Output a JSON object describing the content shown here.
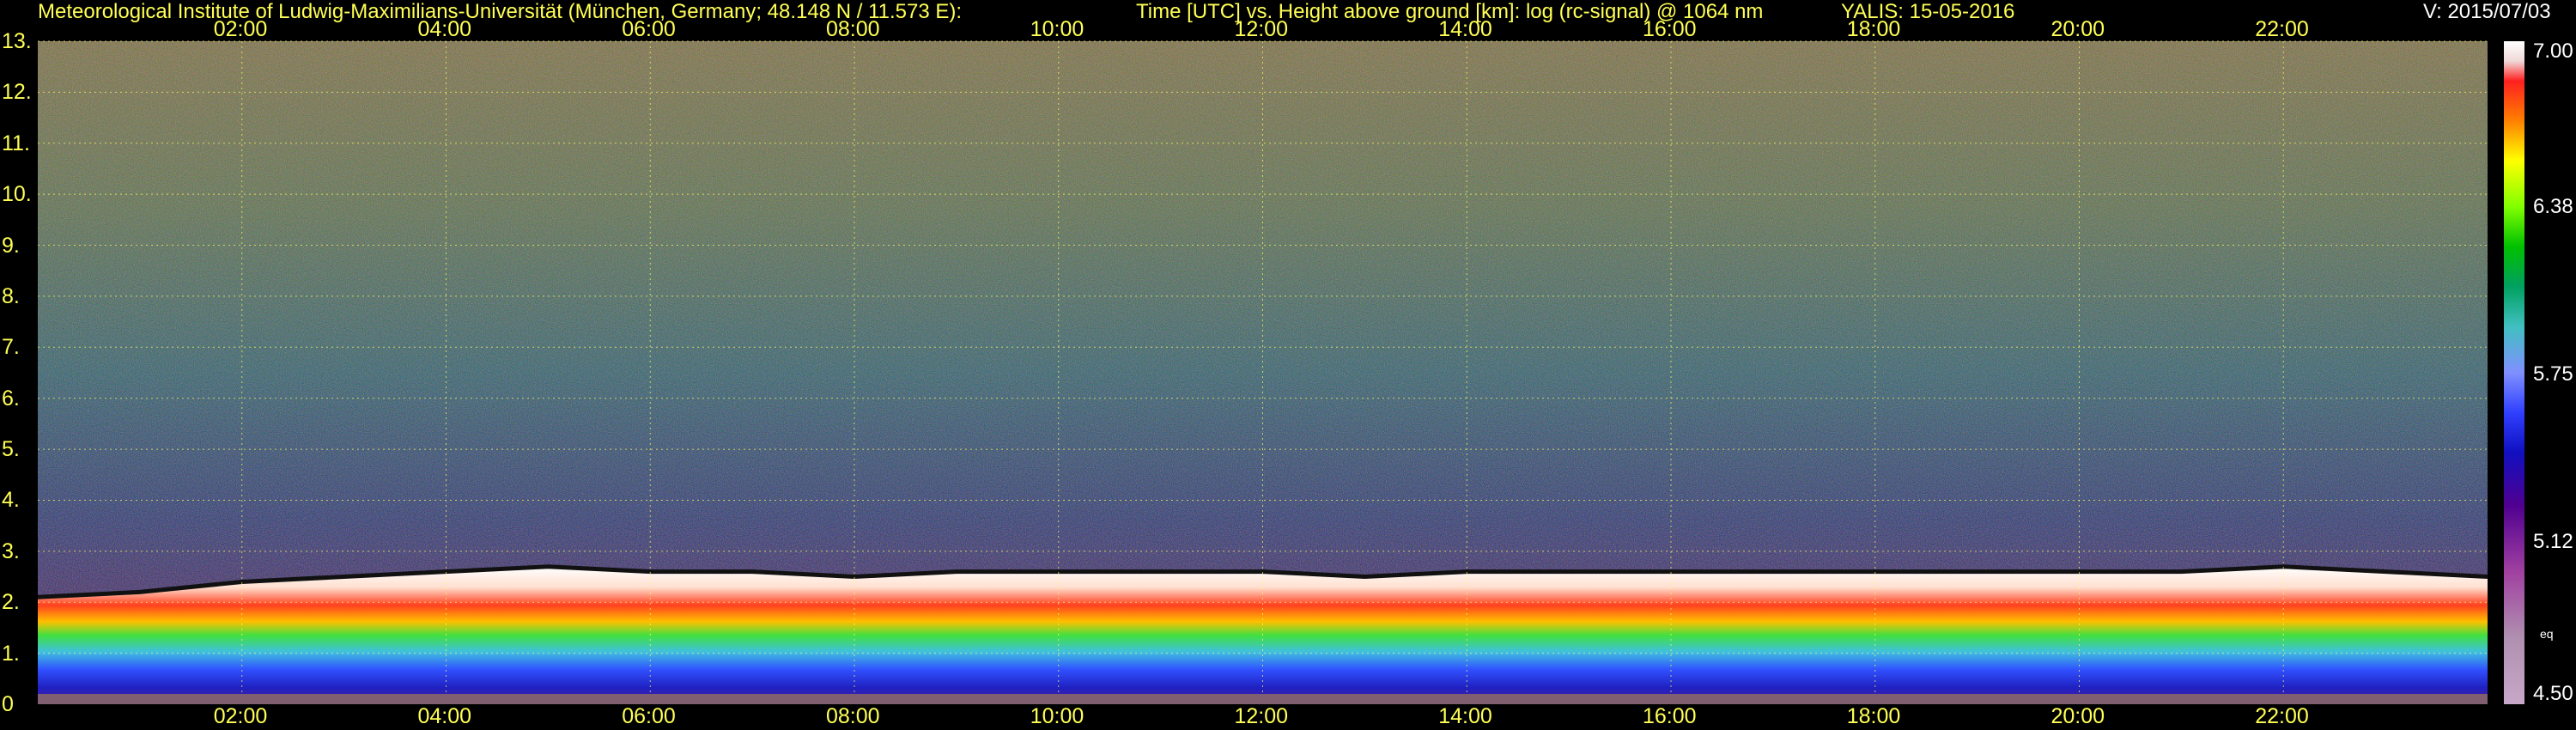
{
  "header": {
    "institute": "Meteorological Institute of Ludwig-Maximilians-Universität (München, Germany; 48.148 N / 11.573 E):",
    "description": "Time [UTC] vs. Height above ground [km]: log (rc-signal) @ 1064 nm",
    "instrument_date": "YALIS: 15-05-2016",
    "version": "V: 2015/07/03"
  },
  "chart_data": {
    "type": "heatmap",
    "title": "Time [UTC] vs. Height above ground [km]: log (rc-signal) @ 1064 nm",
    "x_ticks": [
      "02:00",
      "04:00",
      "06:00",
      "08:00",
      "10:00",
      "12:00",
      "14:00",
      "16:00",
      "18:00",
      "20:00",
      "22:00"
    ],
    "x_tick_hours": [
      2,
      4,
      6,
      8,
      10,
      12,
      14,
      16,
      18,
      20,
      22
    ],
    "xlim": [
      0,
      24
    ],
    "y_ticks": [
      "0",
      "1.",
      "2.",
      "3.",
      "4.",
      "5.",
      "6.",
      "7.",
      "8.",
      "9.",
      "10.",
      "11.",
      "12.",
      "13."
    ],
    "y_tick_values": [
      0,
      1,
      2,
      3,
      4,
      5,
      6,
      7,
      8,
      9,
      10,
      11,
      12,
      13
    ],
    "ylim": [
      0,
      13
    ],
    "grid": true,
    "colorbar": {
      "ticks": [
        "7.00",
        "6.38",
        "5.75",
        "5.12",
        "4.50"
      ],
      "tick_values": [
        7.0,
        6.38,
        5.75,
        5.12,
        4.5
      ],
      "range": [
        4.5,
        7.0
      ],
      "extra_label": "eq"
    },
    "boundary_layer_top_km": [
      [
        0,
        2.1
      ],
      [
        1,
        2.2
      ],
      [
        2,
        2.4
      ],
      [
        3,
        2.5
      ],
      [
        4,
        2.6
      ],
      [
        5,
        2.7
      ],
      [
        6,
        2.6
      ],
      [
        7,
        2.6
      ],
      [
        8,
        2.5
      ],
      [
        9,
        2.6
      ],
      [
        10,
        2.6
      ],
      [
        11,
        2.6
      ],
      [
        12,
        2.6
      ],
      [
        13,
        2.5
      ],
      [
        14,
        2.6
      ],
      [
        15,
        2.6
      ],
      [
        16,
        2.6
      ],
      [
        17,
        2.6
      ],
      [
        18,
        2.6
      ],
      [
        19,
        2.6
      ],
      [
        20,
        2.6
      ],
      [
        21,
        2.6
      ],
      [
        22,
        2.7
      ],
      [
        23,
        2.6
      ],
      [
        24,
        2.5
      ]
    ]
  }
}
